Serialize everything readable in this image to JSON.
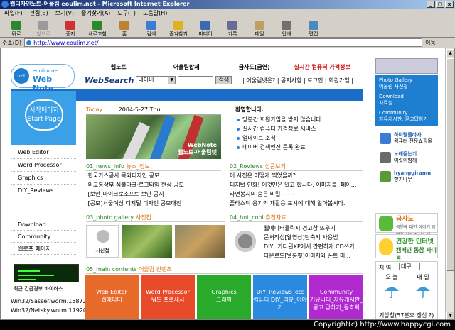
{
  "window": {
    "title": "웹디자인노트-어울림 eoulim.net - Microsoft Internet Explorer",
    "btn_min": "_",
    "btn_max": "□",
    "btn_close": "x"
  },
  "menu": [
    "파일(F)",
    "편집(E)",
    "보기(V)",
    "즐겨찾기(A)",
    "도구(T)",
    "도움말(H)"
  ],
  "toolbar": [
    {
      "label": "뒤로",
      "icon": "back-arrow-icon",
      "color": "#2a8a2a",
      "disabled": false
    },
    {
      "label": "앞으로",
      "icon": "forward-arrow-icon",
      "color": "#9a9a9a",
      "disabled": true
    },
    {
      "label": "중지",
      "icon": "stop-icon",
      "color": "#d03030",
      "disabled": false
    },
    {
      "label": "새로고침",
      "icon": "refresh-icon",
      "color": "#2a8a2a",
      "disabled": false
    },
    {
      "label": "홈",
      "icon": "home-icon",
      "color": "#c08030",
      "disabled": false
    },
    {
      "label": "검색",
      "icon": "search-icon",
      "color": "#3a7bd5",
      "disabled": false
    },
    {
      "label": "즐겨찾기",
      "icon": "favorites-icon",
      "color": "#e0b020",
      "disabled": false
    },
    {
      "label": "미디어",
      "icon": "media-icon",
      "color": "#3a6ab0",
      "disabled": false
    },
    {
      "label": "기록",
      "icon": "history-icon",
      "color": "#6a6a9a",
      "disabled": false
    },
    {
      "label": "메일",
      "icon": "mail-icon",
      "color": "#c0a060",
      "disabled": false
    },
    {
      "label": "인쇄",
      "icon": "print-icon",
      "color": "#707070",
      "disabled": false
    },
    {
      "label": "편집",
      "icon": "edit-icon",
      "color": "#4a8ac0",
      "disabled": false
    }
  ],
  "address": {
    "label": "주소(D)",
    "url": "http://www.eoulim.net/",
    "go": "이동"
  },
  "site": {
    "logo_small": "eoulim.net",
    "logo_big": "Web Note",
    "logo_circle": "net",
    "nav": [
      "웹노트",
      "어울림합체",
      "금사도(금연)",
      "실시간 컴퓨터 가격정보"
    ],
    "search_label": "WebSearch",
    "search_select": "네이버",
    "search_button": "검색",
    "top_links": "| 어울림넷은? | 공지사항 | 로그인 | 회원가입 |",
    "start_line1": "시작페이지",
    "start_line2": "Start Page",
    "side_menu": [
      "Web Editor",
      "Word Processor",
      "Graphics",
      "DIY_Reviews"
    ],
    "side_menu2": [
      "Download",
      "Community",
      "웹로프 페이지"
    ],
    "virus_title": "최근 긴급경보 바이러스",
    "virus_list": [
      "Win32/Sasser.worm.15872",
      "Win32/Netsky.worm.17920"
    ],
    "today_label": "Today",
    "today_date": "2004-5-27 Thu",
    "photo_mark_line1": "WebNote",
    "photo_mark_line2": "웹노트-어울림넷",
    "welcome_title": "환영합니다.",
    "welcome_items": [
      "당분간 회원가입을 받지 않습니다.",
      "실시간 컴퓨터 가격정보 서비스",
      "업데이트 소식",
      "네이버 검색엔진 등록 완료"
    ],
    "news_head": "01_news_info",
    "news_sub": "뉴스_정보",
    "news_items": [
      "·한국가스공사 목외디자인 공모",
      "·외교통상부 심볼마크·로고타입 현상 공모",
      "·[보안]마이크로소프트 보안 공지",
      "·[공모]서울여성 디지털 디자인 공모대전"
    ],
    "reviews_head": "02_Reviews",
    "reviews_sub": "상품보기",
    "reviews_items": [
      "이 사진은 어떻게 찍었을까?",
      "디지털 인화! 이것만은 알고 합시다. 이미지를, 페이...",
      "라면봉지의 숨은 비밀~~~",
      "플라스틱 용기의 재활용 표시에 대해 알아봅시다."
    ],
    "gallery_head": "03_photo gallery",
    "gallery_sub": "사진첩",
    "gallery_thumb_label": "사진첩",
    "hot_head": "04_hot_cool",
    "hot_sub": "추천자료",
    "hot_items": [
      "웹에디터클릭시 경고창 뜨우기",
      "문서작성[웹영상]단축키 사용법",
      "DIY...가타된XP에서 간편하게 CD쓰기",
      "다운로드[텔롱핏]이미지와 폰트 미..."
    ],
    "main_head": "05_main contents",
    "main_sub": "어울림 컨텐츠",
    "blocks": [
      {
        "title": "Web Editor",
        "sub": "웹에디터",
        "color": "#e86a2a"
      },
      {
        "title": "Word Processor",
        "sub": "워드 프로세서",
        "color": "#e84a2a"
      },
      {
        "title": "Graphics",
        "sub": "그래픽",
        "color": "#2aaa2a"
      },
      {
        "title": "DIY_Reviews_etc",
        "sub": "컴퓨터 DIY_리뷰_이야기",
        "color": "#2a8ae0"
      },
      {
        "title": "Community",
        "sub": "커뮤니티_자유게시판_묻고 답하기_동호회",
        "color": "#b02ad0"
      }
    ],
    "right_box": {
      "g1_title": "Photo Gallery",
      "g1_sub": "어울림 사진첩",
      "g2_title": "Download",
      "g2_sub": "자료실",
      "g3_title": "Community",
      "g3_sub": "자유게시판, 묻고답하기"
    },
    "right_links": [
      {
        "t1": "하이텔플라자",
        "t2": "컴퓨터 전문쇼핑몰",
        "color": "#3a7bd5"
      },
      {
        "t1": "노래듣는기",
        "t2": "여럿이함께",
        "color": "#6a6a6a"
      },
      {
        "t1": "hyanggiramu",
        "t2": "향기나무",
        "color": "#5a9a3a"
      }
    ],
    "banner1_title": "금사도",
    "banner1_sub": "금연에 대한 이야기 금연을 사들은 모두에",
    "banner2_title": "건강한 인터넷",
    "banner2_sub": "캠페인 동참 사이트",
    "weather_label": "지 역",
    "weather_region": "대구",
    "weather_days": [
      "오 늘",
      "내 일"
    ],
    "weather_temp": "기상청(57분후 갱신 ?)"
  },
  "status_copyright": "Copyright(c) http://www.happycgi.com"
}
